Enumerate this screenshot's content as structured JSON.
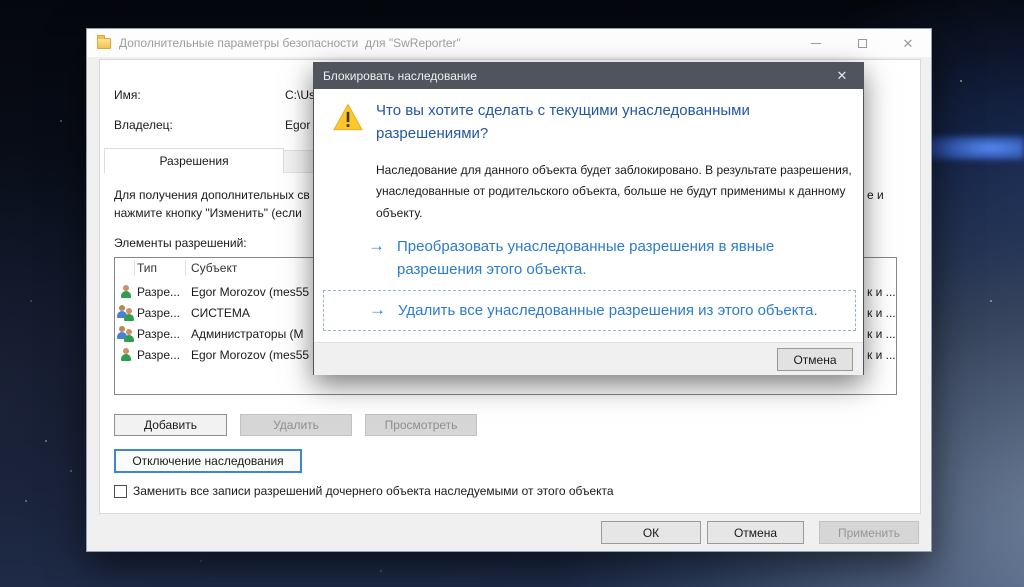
{
  "window": {
    "title": "Дополнительные параметры безопасности  для \"SwReporter\"",
    "caption": {
      "close_glyph": "✕"
    },
    "fields": [
      {
        "label": "Имя:",
        "value": "C:\\Us"
      },
      {
        "label": "Владелец:",
        "value": "Egor"
      }
    ],
    "tabs": [
      {
        "label": "Разрешения",
        "selected": true
      }
    ],
    "description": {
      "line1_left": "Для получения дополнительных св",
      "line1_right": "е и",
      "line2_left": "нажмите кнопку \"Изменить\" (если"
    },
    "permissions_label": "Элементы разрешений:",
    "table": {
      "columns": [
        "Тип",
        "Субъект"
      ],
      "rows": [
        {
          "icon": "user",
          "type": "Разре...",
          "subject": "Egor Morozov (mes55",
          "right_fragment": "к и ..."
        },
        {
          "icon": "group",
          "type": "Разре...",
          "subject": "СИСТЕМА",
          "right_fragment": "к и ..."
        },
        {
          "icon": "group",
          "type": "Разре...",
          "subject": "Администраторы (М",
          "right_fragment": "к и ..."
        },
        {
          "icon": "user",
          "type": "Разре...",
          "subject": "Egor Morozov (mes55",
          "right_fragment": "к и ..."
        }
      ]
    },
    "buttons": {
      "add": "Добавить",
      "remove": "Удалить",
      "view": "Просмотреть",
      "disable_inheritance": "Отключение наследования"
    },
    "checkbox_label": "Заменить все записи разрешений дочернего объекта наследуемыми от этого объекта",
    "footer_buttons": {
      "ok": "ОК",
      "cancel": "Отмена",
      "apply": "Применить"
    }
  },
  "modal": {
    "title": "Блокировать наследование",
    "close_glyph": "✕",
    "heading": "Что вы хотите сделать с текущими унаследованными разрешениями?",
    "body": "Наследование для данного объекта будет заблокировано. В результате разрешения, унаследованные от родительского объекта, больше не будут применимы к данному объекту.",
    "arrow_glyph": "→",
    "links": [
      {
        "text": "Преобразовать унаследованные разрешения в явные разрешения этого объекта."
      },
      {
        "text": "Удалить все унаследованные разрешения из этого объекта.",
        "focused": true
      }
    ],
    "cancel_label": "Отмена"
  },
  "colors": {
    "modal_titlebar": "#50555d",
    "heading_blue": "#2257a4",
    "link_blue": "#2b7cce",
    "warning_yellow": "#fdc82e",
    "focus_button_border": "#3c87d2"
  }
}
